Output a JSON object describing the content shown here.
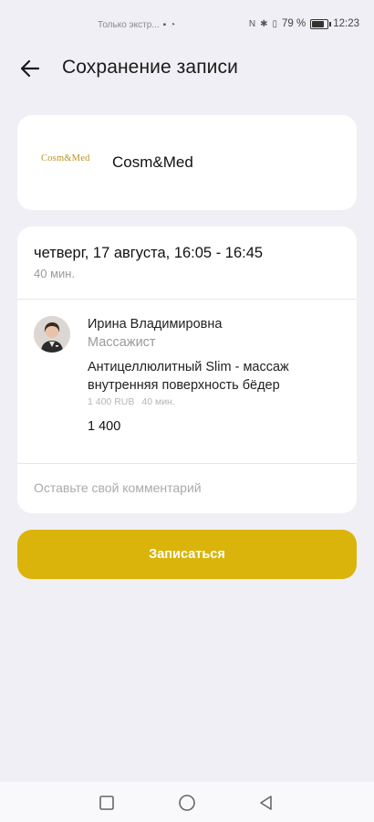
{
  "status_bar": {
    "notification_text": "Только экстр...",
    "signal_icon": "signal-icon",
    "battery_percent": "79 %",
    "battery_level": 0.79,
    "time": "12:23"
  },
  "header": {
    "back_icon": "arrow-left-icon",
    "title": "Сохранение записи"
  },
  "salon": {
    "logo_text": "Cosm&Med",
    "name": "Cosm&Med"
  },
  "booking": {
    "date_time": "четверг, 17 августа, 16:05 - 16:45",
    "duration": "40 мин.",
    "specialist": {
      "name": "Ирина Владимировна",
      "role": "Массажист"
    },
    "service": {
      "name": "Антицеллюлитный Slim - массаж внутренняя поверхность бёдер",
      "price": "1 400 RUB",
      "duration": "40 мин."
    },
    "total": "1 400",
    "comment_placeholder": "Оставьте свой комментарий",
    "comment_value": ""
  },
  "actions": {
    "submit_label": "Записаться"
  },
  "colors": {
    "background": "#f0eff5",
    "accent": "#dab40a",
    "logo": "#b99324"
  }
}
